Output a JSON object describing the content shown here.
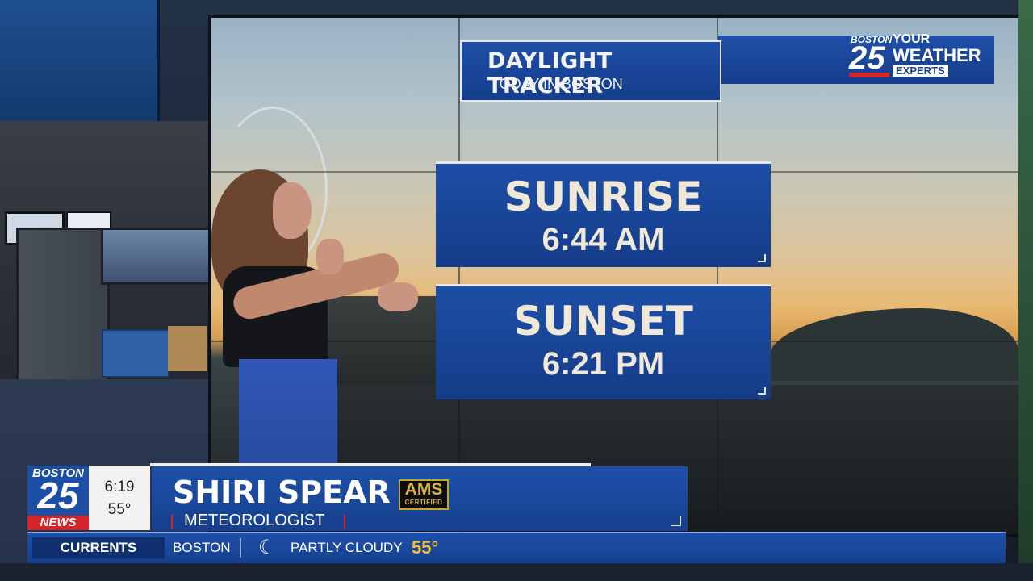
{
  "wall": {
    "header_title": "DAYLIGHT TRACKER",
    "header_subtitle": "TODAY IN BOSTON",
    "logo": {
      "station": "BOSTON",
      "number": "25",
      "line1": "YOUR",
      "line2": "WEATHER",
      "line3": "EXPERTS"
    }
  },
  "sunrise": {
    "label": "SUNRISE",
    "time": "6:44 AM"
  },
  "sunset": {
    "label": "SUNSET",
    "time": "6:21 PM"
  },
  "lower_third": {
    "logo": {
      "station": "BOSTON",
      "number": "25",
      "brand": "NEWS"
    },
    "time": "6:19",
    "temperature": "55°",
    "name": "SHIRI SPEAR",
    "title": "METEOROLOGIST",
    "badge": {
      "line1": "AMS",
      "line2": "CERTIFIED"
    }
  },
  "ticker": {
    "section": "CURRENTS",
    "city": "BOSTON",
    "icon": "moon-cloud-icon",
    "condition": "PARTLY CLOUDY",
    "temperature": "55°"
  },
  "colors": {
    "brand_blue": "#1e50aa",
    "brand_red": "#d6242b",
    "temp_yellow": "#f1c232"
  }
}
